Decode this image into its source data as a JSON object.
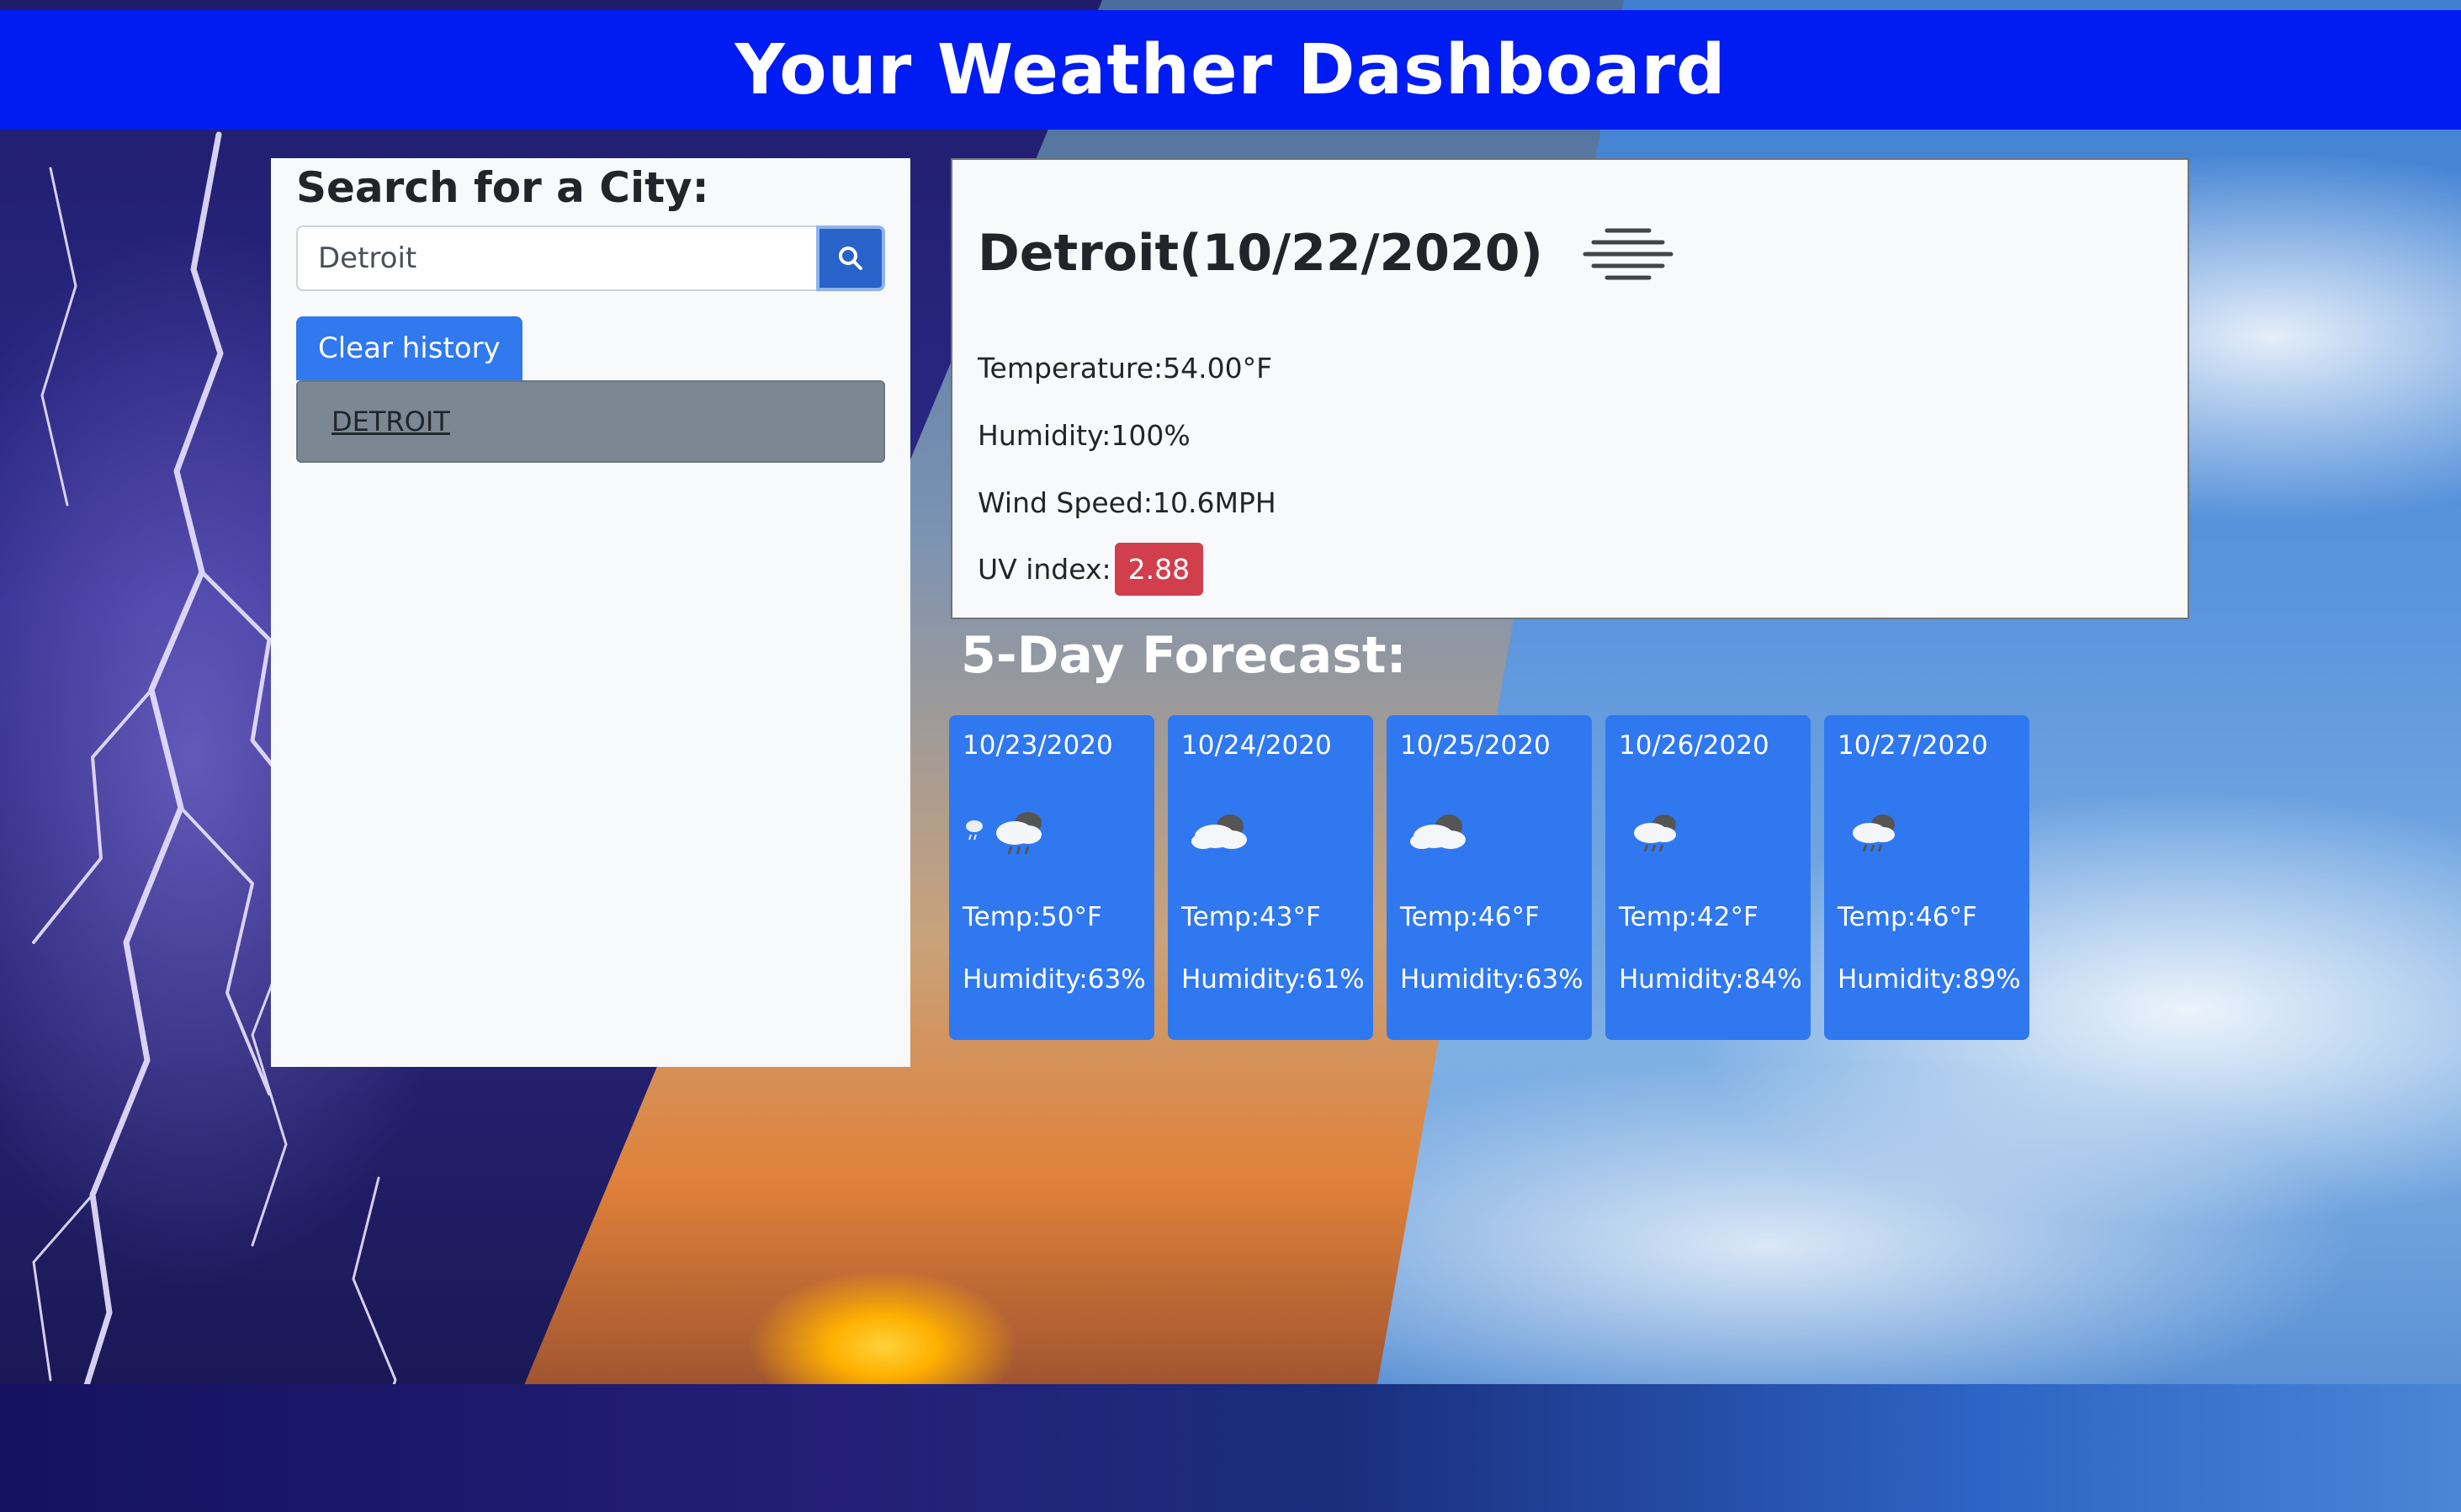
{
  "header": {
    "title": "Your Weather Dashboard"
  },
  "search": {
    "title": "Search for a City:",
    "input_value": "Detroit",
    "search_icon": "search-icon",
    "clear_label": "Clear history",
    "history": [
      "DETROIT"
    ]
  },
  "current": {
    "city_date": "Detroit(10/22/2020)",
    "icon": "mist-icon",
    "temperature": "Temperature:54.00°F",
    "humidity": "Humidity:100%",
    "wind": "Wind Speed:10.6MPH",
    "uv_label": "UV index:",
    "uv_value": "2.88",
    "uv_color": "#d13f4c"
  },
  "forecast": {
    "title": "5-Day Forecast:",
    "days": [
      {
        "date": "10/23/2020",
        "icon": "rain-cloud-icon",
        "temp": "Temp:50°F",
        "humidity": "Humidity:63%"
      },
      {
        "date": "10/24/2020",
        "icon": "cloudy-icon",
        "temp": "Temp:43°F",
        "humidity": "Humidity:61%"
      },
      {
        "date": "10/25/2020",
        "icon": "cloudy-icon",
        "temp": "Temp:46°F",
        "humidity": "Humidity:63%"
      },
      {
        "date": "10/26/2020",
        "icon": "rain-cloud-icon",
        "temp": "Temp:42°F",
        "humidity": "Humidity:84%"
      },
      {
        "date": "10/27/2020",
        "icon": "rain-cloud-icon",
        "temp": "Temp:46°F",
        "humidity": "Humidity:89%"
      }
    ]
  },
  "colors": {
    "header": "#001cf3",
    "primary_button": "#3079ee",
    "forecast_card": "#3078f0",
    "history_item": "#7b8894"
  }
}
